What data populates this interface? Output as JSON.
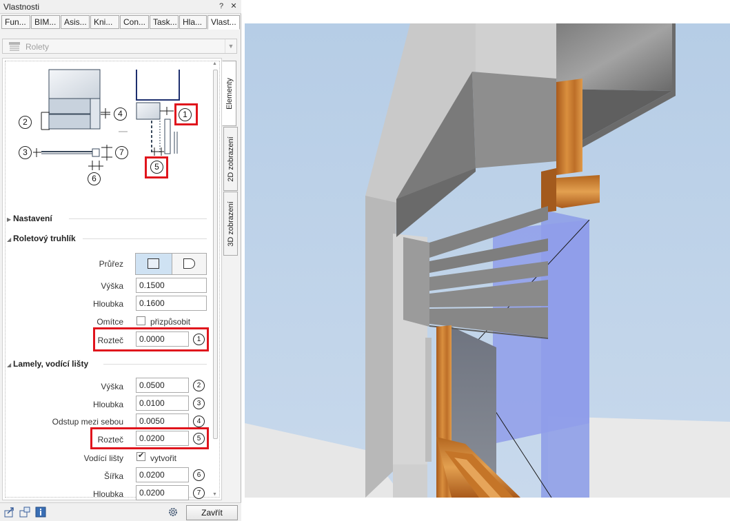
{
  "window": {
    "title": "Vlastnosti",
    "help": "?",
    "close": "✕"
  },
  "tabs": [
    "Fun...",
    "BIM...",
    "Asis...",
    "Kni...",
    "Con...",
    "Task...",
    "Hla...",
    "Vlast..."
  ],
  "active_tab": "Vlast...",
  "combo": {
    "value": "Rolety"
  },
  "side_tabs": [
    "Elementy",
    "2D zobrazení",
    "3D zobrazení"
  ],
  "diagram": {
    "labels": [
      "1",
      "2",
      "3",
      "4",
      "5",
      "6",
      "7"
    ]
  },
  "sections": {
    "nastaveni": "Nastavení",
    "truhlik": "Roletový truhlík",
    "lamely": "Lamely, vodící lišty"
  },
  "truhlik": {
    "prurez_label": "Průřez",
    "vyska_label": "Výška",
    "vyska": "0.1500",
    "hloubka_label": "Hloubka",
    "hloubka": "0.1600",
    "omitce_label": "Omítce",
    "omitce_check": "přizpůsobit",
    "roztec_label": "Rozteč",
    "roztec": "0.0000",
    "roztec_marker": "1"
  },
  "lamely": {
    "vyska_label": "Výška",
    "vyska": "0.0500",
    "vyska_marker": "2",
    "hloubka_label": "Hloubka",
    "hloubka": "0.0100",
    "hloubka_marker": "3",
    "odstup_label": "Odstup mezi sebou",
    "odstup": "0.0050",
    "odstup_marker": "4",
    "roztec_label": "Rozteč",
    "roztec": "0.0200",
    "roztec_marker": "5",
    "listy_label": "Vodící lišty",
    "listy_check": "vytvořit",
    "sirka_label": "Šířka",
    "sirka": "0.0200",
    "sirka_marker": "6",
    "hloubka2_label": "Hloubka",
    "hloubka2": "0.0200",
    "hloubka2_marker": "7"
  },
  "footer": {
    "close_label": "Zavřít"
  },
  "colors": {
    "highlight": "#e0141c",
    "sky": "#b9d0e9",
    "glass": "#8e9fe8",
    "concrete": "#9a9a9a",
    "wood": "#c77a2e"
  }
}
